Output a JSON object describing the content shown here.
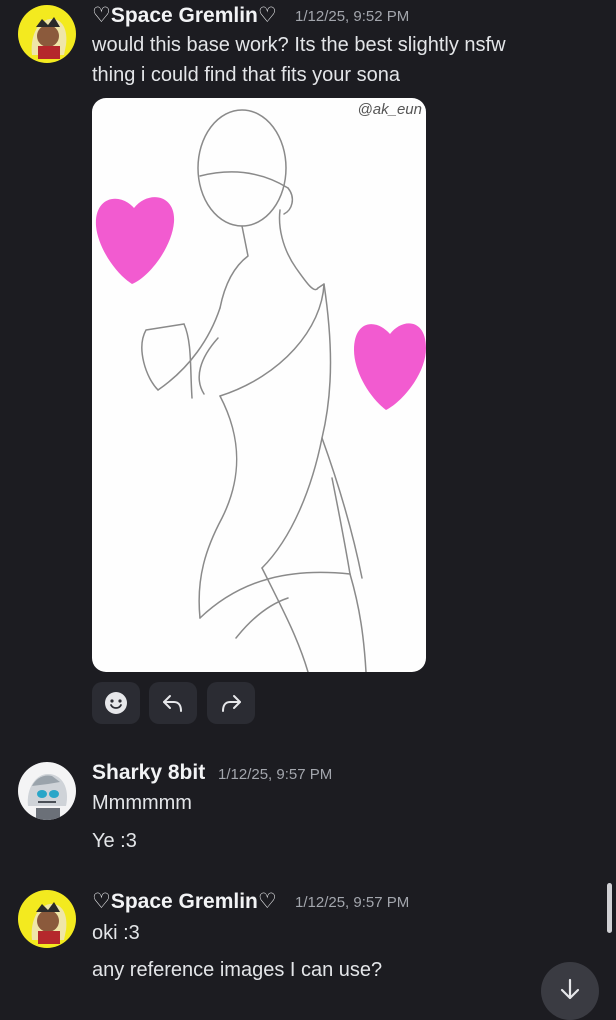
{
  "messages": [
    {
      "author": "♡Space Gremlin♡",
      "timestamp": "1/12/25, 9:52 PM",
      "lines": [
        "would this base work? Its the best slightly nsfw",
        "thing i could find that fits your sona"
      ],
      "avatar_icon": "character-avatar",
      "attachment": {
        "watermark": "@ak_eun",
        "accent_color": "#f25bd0"
      }
    },
    {
      "author": "Sharky 8bit",
      "timestamp": "1/12/25, 9:57 PM",
      "lines": [
        "Mmmmmm",
        "Ye :3"
      ],
      "avatar_icon": "character-avatar"
    },
    {
      "author": "♡Space Gremlin♡",
      "timestamp": "1/12/25, 9:57 PM",
      "lines": [
        "oki :3",
        "any reference images I can use?"
      ],
      "avatar_icon": "character-avatar"
    }
  ],
  "actions": [
    "add-reaction-icon",
    "reply-icon",
    "forward-icon"
  ],
  "jump_to_bottom_icon": "arrow-down-icon",
  "colors": {
    "background": "#1c1c21",
    "accent_heart": "#f25bd0",
    "avatar_yellow": "#f3ea1f"
  }
}
